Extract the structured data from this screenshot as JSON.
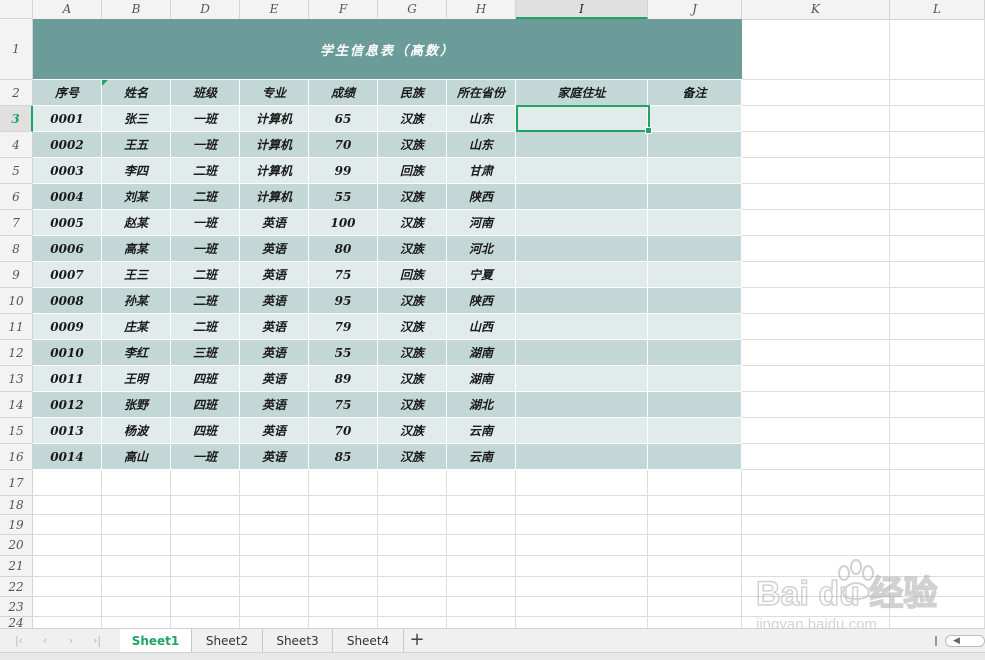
{
  "columns": [
    "A",
    "B",
    "D",
    "E",
    "F",
    "G",
    "H",
    "I",
    "J",
    "K",
    "L"
  ],
  "rows": [
    "1",
    "2",
    "3",
    "4",
    "5",
    "6",
    "7",
    "8",
    "9",
    "10",
    "11",
    "12",
    "13",
    "14",
    "15",
    "16",
    "17",
    "18",
    "19",
    "20",
    "21",
    "22",
    "23",
    "24"
  ],
  "title": "学生信息表（高数）",
  "headers": [
    "序号",
    "姓名",
    "班级",
    "专业",
    "成绩",
    "民族",
    "所在省份",
    "家庭住址",
    "备注"
  ],
  "records": [
    [
      "0001",
      "张三",
      "一班",
      "计算机",
      "65",
      "汉族",
      "山东"
    ],
    [
      "0002",
      "王五",
      "一班",
      "计算机",
      "70",
      "汉族",
      "山东"
    ],
    [
      "0003",
      "李四",
      "二班",
      "计算机",
      "99",
      "回族",
      "甘肃"
    ],
    [
      "0004",
      "刘某",
      "二班",
      "计算机",
      "55",
      "汉族",
      "陕西"
    ],
    [
      "0005",
      "赵某",
      "一班",
      "英语",
      "100",
      "汉族",
      "河南"
    ],
    [
      "0006",
      "高某",
      "一班",
      "英语",
      "80",
      "汉族",
      "河北"
    ],
    [
      "0007",
      "王三",
      "二班",
      "英语",
      "75",
      "回族",
      "宁夏"
    ],
    [
      "0008",
      "孙某",
      "二班",
      "英语",
      "95",
      "汉族",
      "陕西"
    ],
    [
      "0009",
      "庄某",
      "二班",
      "英语",
      "79",
      "汉族",
      "山西"
    ],
    [
      "0010",
      "李红",
      "三班",
      "英语",
      "55",
      "汉族",
      "湖南"
    ],
    [
      "0011",
      "王明",
      "四班",
      "英语",
      "89",
      "汉族",
      "湖南"
    ],
    [
      "0012",
      "张野",
      "四班",
      "英语",
      "75",
      "汉族",
      "湖北"
    ],
    [
      "0013",
      "杨波",
      "四班",
      "英语",
      "70",
      "汉族",
      "云南"
    ],
    [
      "0014",
      "高山",
      "一班",
      "英语",
      "85",
      "汉族",
      "云南"
    ]
  ],
  "sheets": [
    "Sheet1",
    "Sheet2",
    "Sheet3",
    "Sheet4"
  ],
  "active_sheet": "Sheet1",
  "active_cell": "I3",
  "add_sheet_label": "+",
  "colors": {
    "title_bg": "#6b9c9a",
    "row_dark": "#c3d8d6",
    "row_light": "#e0ebea",
    "header_bg": "#c3d8d6",
    "accent": "#21a366"
  },
  "watermark": {
    "brand": "Bai du 经验",
    "url": "jingyan.baidu.com"
  }
}
